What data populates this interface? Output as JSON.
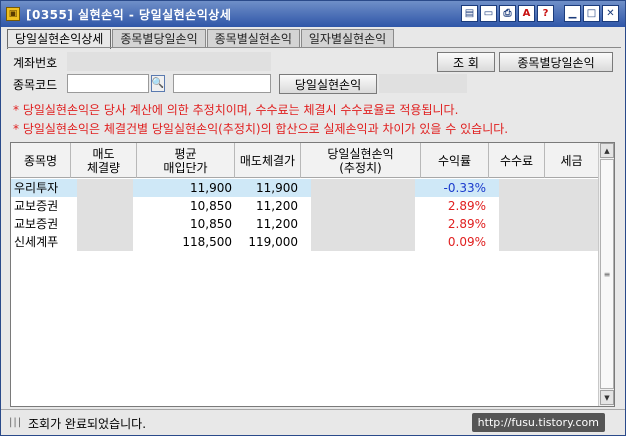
{
  "window": {
    "title": "[0355] 실현손익 - 당일실현손익상세",
    "controls": [
      {
        "name": "layout-icon",
        "glyph": "▤"
      },
      {
        "name": "window-icon",
        "glyph": "▭"
      },
      {
        "name": "print-icon",
        "glyph": "⎙"
      },
      {
        "name": "font-icon",
        "glyph": "A"
      },
      {
        "name": "help-icon",
        "glyph": "?"
      },
      {
        "name": "minimize-icon",
        "glyph": "▁"
      },
      {
        "name": "maximize-icon",
        "glyph": "□"
      },
      {
        "name": "close-icon",
        "glyph": "✕"
      }
    ]
  },
  "tabs": [
    {
      "label": "당일실현손익상세",
      "active": true
    },
    {
      "label": "종목별당일손익",
      "active": false
    },
    {
      "label": "종목별실현손익",
      "active": false
    },
    {
      "label": "일자별실현손익",
      "active": false
    }
  ],
  "form": {
    "account_label": "계좌번호",
    "account_value": "",
    "stock_label": "종목코드",
    "stock_value": "",
    "stock_name_value": "",
    "search_button": "조 회",
    "per_stock_button": "종목별당일손익",
    "realized_button": "당일실현손익",
    "realized_value": ""
  },
  "notices": [
    "* 당일실현손익은 당사 계산에 의한 추정치이며, 수수료는 체결시 수수료율로 적용됩니다.",
    "* 당일실현손익은 체결건별 당일실현손익(추정치)의 합산으로 실제손익과 차이가 있을 수 있습니다."
  ],
  "table": {
    "headers": [
      "종목명",
      "매도\n체결량",
      "평균\n매입단가",
      "매도체결가",
      "당일실현손익\n(추정치)",
      "수익률",
      "수수료",
      "세금"
    ],
    "rows": [
      {
        "name": "우리투자",
        "qty": "",
        "avg_price": "11,900",
        "sell_price": "11,900",
        "pnl": "",
        "rate": "-0.33%",
        "fee": "",
        "tax": "",
        "selected": true
      },
      {
        "name": "교보증권",
        "qty": "",
        "avg_price": "10,850",
        "sell_price": "11,200",
        "pnl": "",
        "rate": "2.89%",
        "fee": "",
        "tax": "",
        "selected": false
      },
      {
        "name": "교보증권",
        "qty": "",
        "avg_price": "10,850",
        "sell_price": "11,200",
        "pnl": "",
        "rate": "2.89%",
        "fee": "",
        "tax": "",
        "selected": false
      },
      {
        "name": "신세계푸",
        "qty": "",
        "avg_price": "118,500",
        "sell_price": "119,000",
        "pnl": "",
        "rate": "0.09%",
        "fee": "",
        "tax": "",
        "selected": false
      }
    ]
  },
  "status": {
    "message": "조회가 완료되었습니다.",
    "watermark": "http://fusu.tistory.com"
  },
  "colors": {
    "title_bar": "#2f56a8",
    "notice": "#e02020",
    "positive": "#e02020",
    "negative": "#1a3acc",
    "selected_row": "#cfe8f7",
    "masked": "#e0e0e0"
  }
}
